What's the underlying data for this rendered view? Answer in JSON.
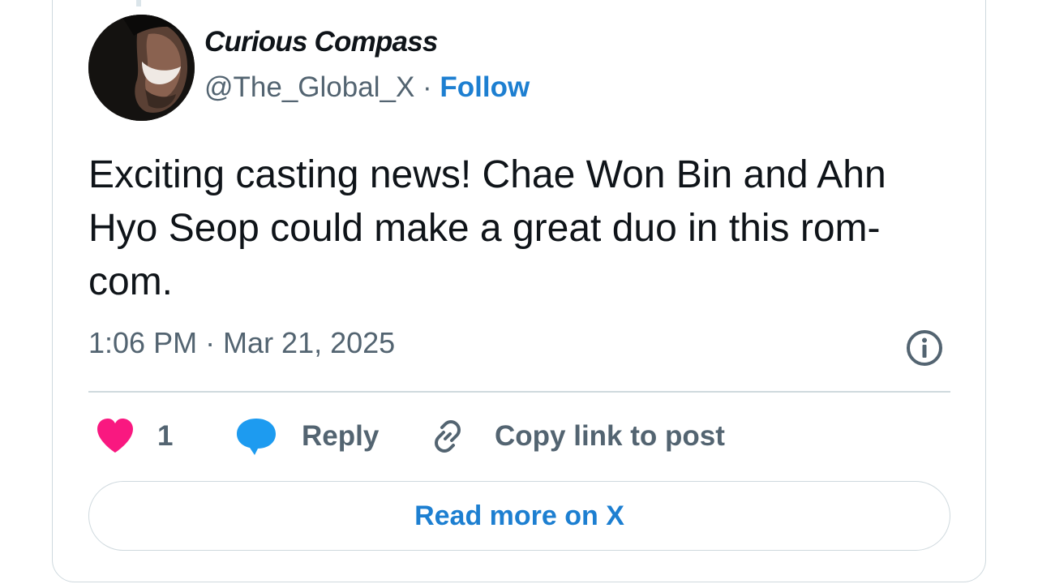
{
  "tweet": {
    "author_name": "Curious Compass",
    "handle": "@The_Global_X",
    "separator": " · ",
    "follow_label": "Follow",
    "text": "Exciting casting news! Chae Won Bin and Ahn Hyo Seop could make a great duo in this rom-com.",
    "timestamp": "1:06 PM · Mar 21, 2025"
  },
  "actions": {
    "like_count": "1",
    "reply_label": "Reply",
    "copy_label": "Copy link to post"
  },
  "footer": {
    "read_more_label": "Read more on X"
  },
  "icons": {
    "like": "heart-icon",
    "reply": "speech-bubble-icon",
    "copy": "link-icon",
    "info": "info-icon"
  },
  "colors": {
    "heart": "#f91880",
    "reply": "#1d9bf0",
    "link_blue": "#1d7fd1",
    "muted": "#536471",
    "text": "#0f1419",
    "border": "#cfd9de"
  }
}
